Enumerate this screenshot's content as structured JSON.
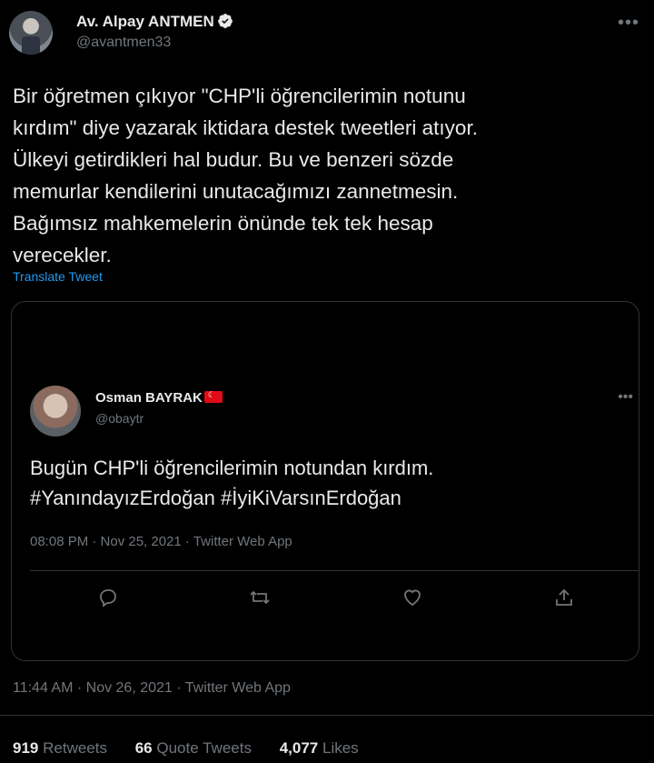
{
  "author": {
    "name": "Av. Alpay ANTMEN",
    "handle": "@avantmen33"
  },
  "tweet": {
    "text": "Bir öğretmen çıkıyor \"CHP'li öğrencilerimin notunu\nkırdım\" diye yazarak iktidara destek tweetleri atıyor.\nÜlkeyi getirdikleri hal budur. Bu ve benzeri sözde\nmemurlar kendilerini unutacağımızı zannetmesin.\nBağımsız mahkemelerin önünde tek tek hesap\nverecekler.",
    "translate_label": "Translate Tweet",
    "timestamp": "11:44 AM · Nov 26, 2021 · Twitter Web App"
  },
  "quoted": {
    "name": "Osman BAYRAK",
    "handle": "@obaytr",
    "text": "Bugün CHP'li öğrencilerimin notundan kırdım.\n#YanındayızErdoğan #İyiKiVarsınErdoğan",
    "timestamp": "08:08 PM · Nov 25, 2021 · Twitter Web App",
    "actions": [
      "reply-icon",
      "retweet-icon",
      "like-icon",
      "share-icon"
    ]
  },
  "stats": {
    "retweets_count": "919",
    "retweets_label": "Retweets",
    "quotes_count": "66",
    "quotes_label": "Quote Tweets",
    "likes_count": "4,077",
    "likes_label": "Likes"
  },
  "colors": {
    "background": "#000000",
    "text": "#e7e9ea",
    "muted": "#71767b",
    "link": "#1d9bf0",
    "border": "#2f3336",
    "verified": "#1d9bf0"
  }
}
